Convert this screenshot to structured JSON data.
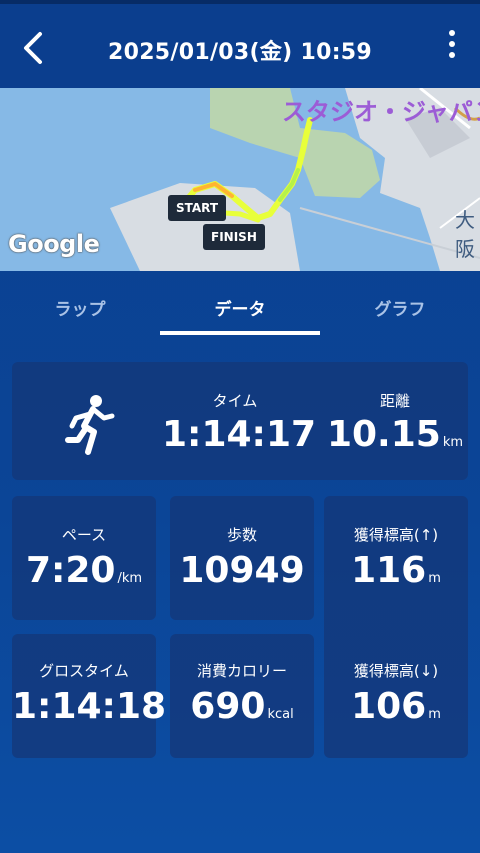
{
  "header": {
    "title": "2025/01/03(金) 10:59",
    "back_icon": "chevron-left-icon",
    "menu_icon": "more-vert-icon"
  },
  "map": {
    "poi_label": "スタジオ・ジャパン",
    "area_label": "大阪",
    "google_logo": "Google",
    "start_label": "START",
    "finish_label": "FINISH"
  },
  "tabs": [
    {
      "label": "ラップ",
      "active": false
    },
    {
      "label": "データ",
      "active": true
    },
    {
      "label": "グラフ",
      "active": false
    }
  ],
  "stats": {
    "time": {
      "label": "タイム",
      "value": "1:14:17"
    },
    "distance": {
      "label": "距離",
      "value": "10.15",
      "unit": "km"
    },
    "pace": {
      "label": "ペース",
      "value": "7:20",
      "unit": "/km"
    },
    "steps": {
      "label": "歩数",
      "value": "10949"
    },
    "ascent": {
      "label": "獲得標高(↑)",
      "value": "116",
      "unit": "m"
    },
    "gross_time": {
      "label": "グロスタイム",
      "value": "1:14:18"
    },
    "calories": {
      "label": "消費カロリー",
      "value": "690",
      "unit": "kcal"
    },
    "descent": {
      "label": "獲得標高(↓)",
      "value": "106",
      "unit": "m"
    }
  },
  "colors": {
    "header_bg": "#0b3e8e",
    "background": "#0b4597",
    "card_bg": "#143778",
    "tab_inactive": "#a9c2e6",
    "route_start": "#f4ff3a",
    "route_mid": "#ffb432"
  }
}
